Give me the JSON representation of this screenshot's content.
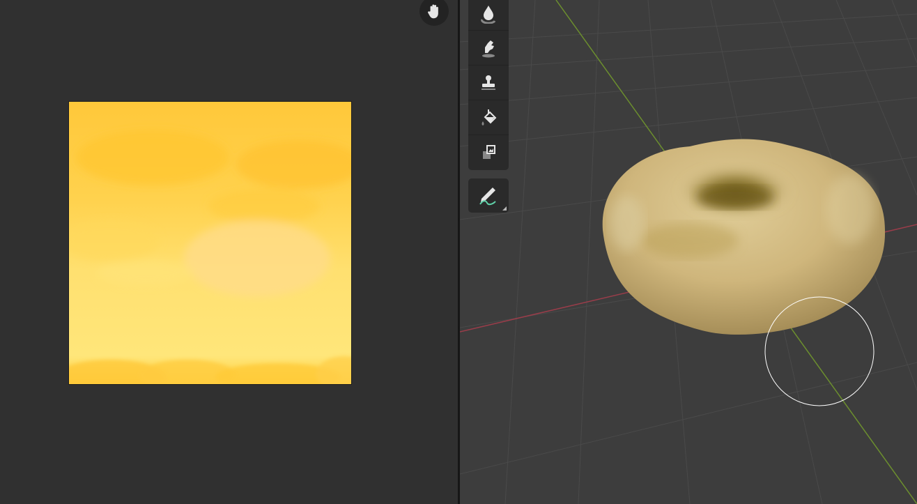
{
  "image_editor": {
    "texture_name_icon": "image-texture",
    "pan_icon": "hand-pan-icon"
  },
  "viewport": {
    "object": "torus",
    "tools": [
      {
        "name": "soften",
        "icon": "drop-icon"
      },
      {
        "name": "smear",
        "icon": "smear-hand-icon"
      },
      {
        "name": "clone",
        "icon": "stamp-icon"
      },
      {
        "name": "fill",
        "icon": "paint-bucket-icon"
      },
      {
        "name": "mask",
        "icon": "mask-squares-icon"
      }
    ],
    "annotate_tool": {
      "name": "annotate",
      "icon": "pencil-wave-icon"
    }
  },
  "colors": {
    "editor_bg": "#303030",
    "viewport_bg": "#3d3d3d",
    "x_axis": "#9a3d4a",
    "y_axis": "#6c8f2e",
    "grid": "#4a4a4a",
    "texture_yellow": "#ffd23a",
    "torus_base": "#cdb47c"
  }
}
